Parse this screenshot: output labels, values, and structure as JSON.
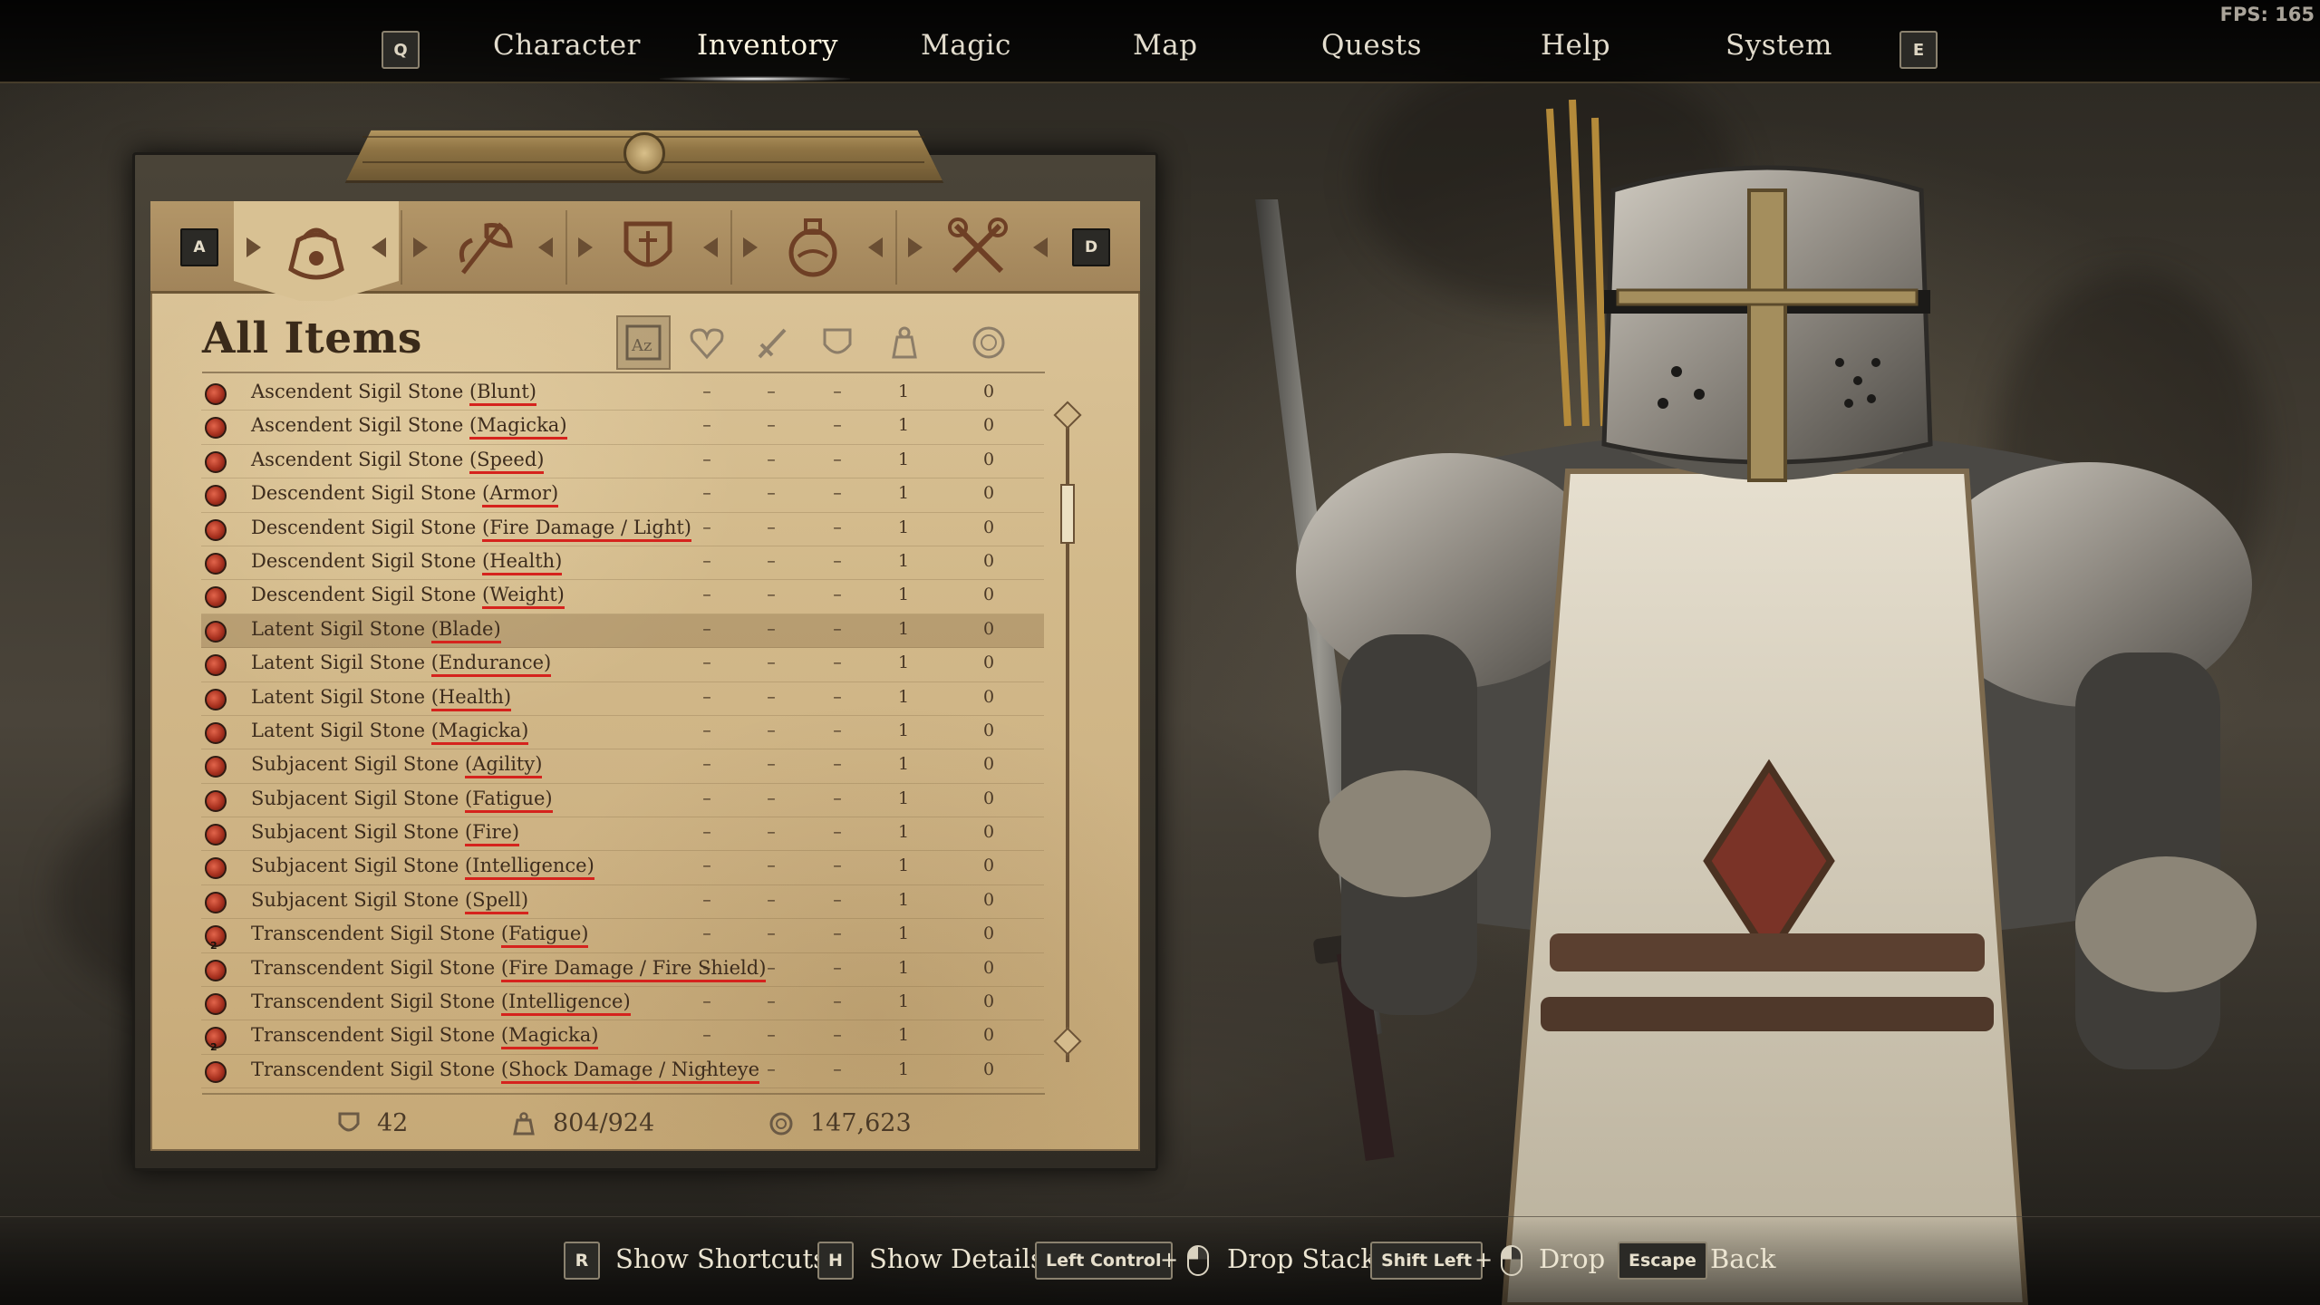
{
  "fps": "FPS: 165",
  "nav": {
    "prev_key": "Q",
    "next_key": "E",
    "tabs": [
      {
        "label": "Character"
      },
      {
        "label": "Inventory"
      },
      {
        "label": "Magic"
      },
      {
        "label": "Map"
      },
      {
        "label": "Quests"
      },
      {
        "label": "Help"
      },
      {
        "label": "System"
      }
    ],
    "active_tab": "Inventory"
  },
  "categories": {
    "prev_key": "A",
    "next_key": "D",
    "tabs": [
      {
        "icon": "pouch-icon",
        "active": true
      },
      {
        "icon": "axe-icon",
        "active": false
      },
      {
        "icon": "armor-icon",
        "active": false
      },
      {
        "icon": "potion-icon",
        "active": false
      },
      {
        "icon": "tools-icon",
        "active": false
      }
    ]
  },
  "list": {
    "title": "All Items",
    "sort_columns": [
      "az-sort-icon",
      "heart-icon",
      "sword-icon",
      "shield-icon",
      "weight-icon",
      "gold-icon"
    ],
    "items": [
      {
        "base": "Ascendent Sigil Stone",
        "variant": "(Blunt)",
        "c1": "–",
        "c2": "–",
        "c3": "–",
        "weight": "1",
        "value": "0",
        "stack": ""
      },
      {
        "base": "Ascendent Sigil Stone",
        "variant": "(Magicka)",
        "c1": "–",
        "c2": "–",
        "c3": "–",
        "weight": "1",
        "value": "0",
        "stack": ""
      },
      {
        "base": "Ascendent Sigil Stone",
        "variant": "(Speed)",
        "c1": "–",
        "c2": "–",
        "c3": "–",
        "weight": "1",
        "value": "0",
        "stack": ""
      },
      {
        "base": "Descendent Sigil Stone",
        "variant": "(Armor)",
        "c1": "–",
        "c2": "–",
        "c3": "–",
        "weight": "1",
        "value": "0",
        "stack": ""
      },
      {
        "base": "Descendent Sigil Stone",
        "variant": "(Fire Damage / Light)",
        "c1": "–",
        "c2": "–",
        "c3": "–",
        "weight": "1",
        "value": "0",
        "stack": ""
      },
      {
        "base": "Descendent Sigil Stone",
        "variant": "(Health)",
        "c1": "–",
        "c2": "–",
        "c3": "–",
        "weight": "1",
        "value": "0",
        "stack": ""
      },
      {
        "base": "Descendent Sigil Stone",
        "variant": "(Weight)",
        "c1": "–",
        "c2": "–",
        "c3": "–",
        "weight": "1",
        "value": "0",
        "stack": ""
      },
      {
        "base": "Latent Sigil Stone",
        "variant": "(Blade)",
        "c1": "–",
        "c2": "–",
        "c3": "–",
        "weight": "1",
        "value": "0",
        "stack": "",
        "selected": true
      },
      {
        "base": "Latent Sigil Stone",
        "variant": "(Endurance)",
        "c1": "–",
        "c2": "–",
        "c3": "–",
        "weight": "1",
        "value": "0",
        "stack": ""
      },
      {
        "base": "Latent Sigil Stone",
        "variant": "(Health)",
        "c1": "–",
        "c2": "–",
        "c3": "–",
        "weight": "1",
        "value": "0",
        "stack": ""
      },
      {
        "base": "Latent Sigil Stone",
        "variant": "(Magicka)",
        "c1": "–",
        "c2": "–",
        "c3": "–",
        "weight": "1",
        "value": "0",
        "stack": ""
      },
      {
        "base": "Subjacent Sigil Stone",
        "variant": "(Agility)",
        "c1": "–",
        "c2": "–",
        "c3": "–",
        "weight": "1",
        "value": "0",
        "stack": ""
      },
      {
        "base": "Subjacent Sigil Stone",
        "variant": "(Fatigue)",
        "c1": "–",
        "c2": "–",
        "c3": "–",
        "weight": "1",
        "value": "0",
        "stack": ""
      },
      {
        "base": "Subjacent Sigil Stone",
        "variant": "(Fire)",
        "c1": "–",
        "c2": "–",
        "c3": "–",
        "weight": "1",
        "value": "0",
        "stack": ""
      },
      {
        "base": "Subjacent Sigil Stone",
        "variant": "(Intelligence)",
        "c1": "–",
        "c2": "–",
        "c3": "–",
        "weight": "1",
        "value": "0",
        "stack": ""
      },
      {
        "base": "Subjacent Sigil Stone",
        "variant": "(Spell)",
        "c1": "–",
        "c2": "–",
        "c3": "–",
        "weight": "1",
        "value": "0",
        "stack": ""
      },
      {
        "base": "Transcendent Sigil Stone",
        "variant": "(Fatigue)",
        "c1": "–",
        "c2": "–",
        "c3": "–",
        "weight": "1",
        "value": "0",
        "stack": "2"
      },
      {
        "base": "Transcendent Sigil Stone",
        "variant": "(Fire Damage / Fire Shield)",
        "c1": "–",
        "c2": "–",
        "c3": "–",
        "weight": "1",
        "value": "0",
        "stack": ""
      },
      {
        "base": "Transcendent Sigil Stone",
        "variant": "(Intelligence)",
        "c1": "–",
        "c2": "–",
        "c3": "–",
        "weight": "1",
        "value": "0",
        "stack": ""
      },
      {
        "base": "Transcendent Sigil Stone",
        "variant": "(Magicka)",
        "c1": "–",
        "c2": "–",
        "c3": "–",
        "weight": "1",
        "value": "0",
        "stack": "2"
      },
      {
        "base": "Transcendent Sigil Stone",
        "variant": "(Shock Damage / Nighteye",
        "c1": "–",
        "c2": "–",
        "c3": "–",
        "weight": "1",
        "value": "0",
        "stack": ""
      }
    ],
    "scroll_position": 0.1
  },
  "stats": {
    "armor": "42",
    "weight": "804/924",
    "gold": "147,623"
  },
  "hints": {
    "shortcuts_key": "R",
    "shortcuts_label": "Show Shortcuts",
    "details_key": "H",
    "details_label": "Show Details",
    "drop_stack_key": "Left Control",
    "drop_stack_plus": "+",
    "drop_stack_label": "Drop Stack",
    "drop_key": "Shift Left",
    "drop_plus": "+",
    "drop_label": "Drop",
    "back_key": "Escape",
    "back_label": "Back"
  },
  "colors": {
    "parchment": "#d2b98a",
    "ink": "#3d2c1d",
    "underline": "#d5231d",
    "item_icon": "#c0402a"
  }
}
